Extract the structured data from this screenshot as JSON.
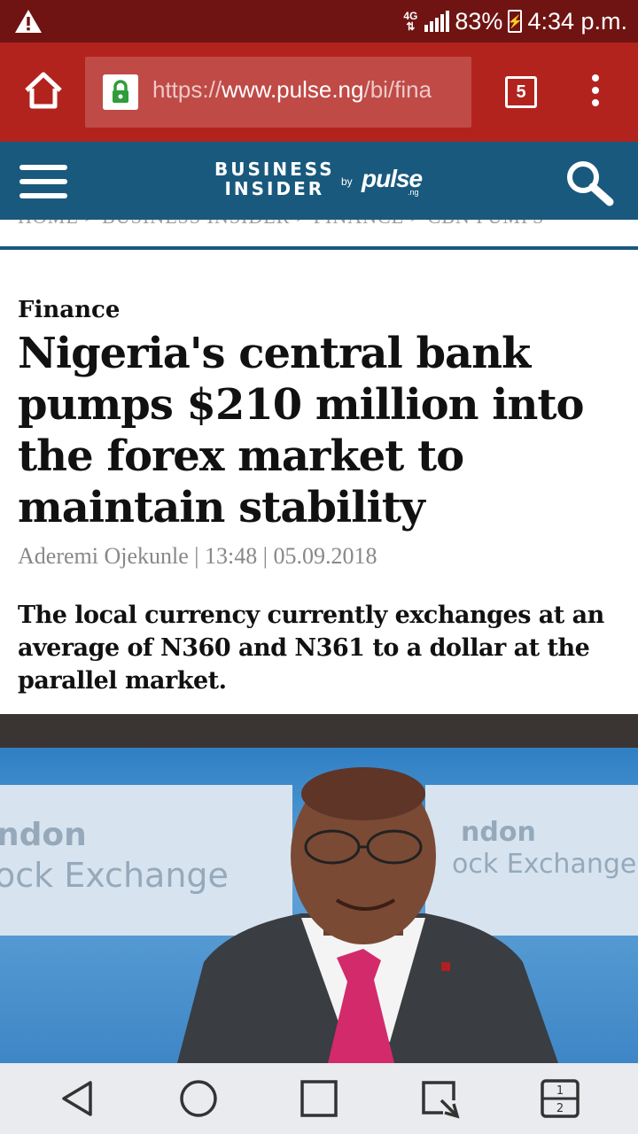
{
  "status": {
    "network": "4G",
    "battery": "83%",
    "time": "4:34 p.m."
  },
  "browser": {
    "url_scheme": "https://",
    "url_host": "www.pulse.ng",
    "url_path": "/bi/fina",
    "tab_count": "5"
  },
  "site": {
    "logo_top": "BUSINESS",
    "logo_bottom": "INSIDER",
    "logo_by": "by",
    "logo_pulse": "pulse",
    "logo_ng": ".ng"
  },
  "breadcrumb": "HOME  >  BUSINESS INSIDER  >  FINANCE  >  CBN PUMPS",
  "article": {
    "category": "Finance",
    "headline": "Nigeria's central bank pumps $210 million into the forex market to maintain stability",
    "author": "Aderemi Ojekunle",
    "time": "13:48",
    "date": "05.09.2018",
    "lede": "The local currency currently exchanges at an average of N360 and N361 to a dollar at the parallel market."
  },
  "hero": {
    "backdrop_left": "ndon",
    "backdrop_left2": "ock Exchange",
    "backdrop_right": "ndon",
    "backdrop_right2": "ock Exchange"
  },
  "colors": {
    "status_bar": "#6f1413",
    "browser_bar": "#b3231e",
    "site_header": "#19597e"
  }
}
